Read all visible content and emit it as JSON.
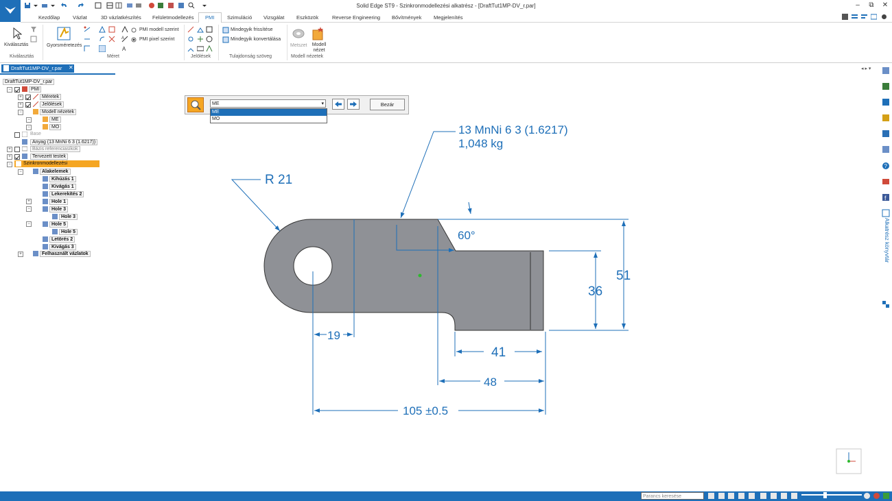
{
  "window": {
    "title": "Solid Edge ST9 - Szinkronmodellezési alkatrész - [DraftTut1MP-DV_r.par]"
  },
  "tabs": [
    "Kezdőlap",
    "Vázlat",
    "3D vázlatkészítés",
    "Felületmodellezés",
    "PMI",
    "Szimuláció",
    "Vizsgálat",
    "Eszközök",
    "Reverse Engineering",
    "Bővítmények",
    "Megjelenítés"
  ],
  "ribbon": {
    "select_label": "Kiválasztás",
    "select_group": "Kiválasztás",
    "quickdim_label": "Gyorsméretezés",
    "meret_group": "Méret",
    "pmi_model_label": "PMI modell szerint",
    "pmi_pixel_label": "PMI pixel szerint",
    "jelolesek_group": "Jelölések",
    "refresh_all_label": "Mindegyik frissítése",
    "convert_all_label": "Mindegyik konvertálása",
    "prop_text_group": "Tulajdonság szöveg",
    "section_label": "Metszet",
    "model_view_label": "Modell nézet",
    "model_views_group": "Modell nézetek"
  },
  "document": {
    "tab_label": "DraftTut1MP-DV_r.par",
    "close_glyph": "✕",
    "nav_arrows": "◂ ▸ ▾"
  },
  "tree": {
    "root": "DraftTut1MP-DV_r.par",
    "pmi": "PMI",
    "meretek": "Méretek",
    "jelolesek": "Jelölések",
    "modell_nezetek": "Modell nézetek",
    "view_me": "ME",
    "view_mo": "MO",
    "base": "Base",
    "anyag": "Anyag (13 MnNi 6 3  (1.6217))",
    "bazis": "Bázis referenciasíkok",
    "tervezett": "Tervezett testek",
    "szinkron": "Szinkronmodellezési",
    "alakelemek": "Alakelemek",
    "kihuzas1": "Kihúzás 1",
    "kivagas1": "Kivágás 1",
    "lekerekites2": "Lekerekítés 2",
    "hole1": "Hole 1",
    "hole3": "Hole 3",
    "hole3_child": "Hole 3",
    "hole5": "Hole 5",
    "hole5_child": "Hole 5",
    "letores2": "Letörés 2",
    "kivagas3": "Kivágás 3",
    "felhasznalt": "Felhasznált vázlatok"
  },
  "view_dialog": {
    "selected": "ME",
    "options": [
      "ME",
      "MO"
    ],
    "close_label": "Bezár"
  },
  "drawing": {
    "material": "13 MnNi 6 3  (1.6217)",
    "mass": "1,048 kg",
    "radius": "R 21",
    "angle": "60°",
    "dim_19": "19",
    "dim_36": "36",
    "dim_51": "51",
    "dim_41": "41",
    "dim_48": "48",
    "dim_105": "105 ±0.5",
    "dim_color": "#1e6fb8",
    "part_color": "#8f9196"
  },
  "rightbar": {
    "library_label": "Alkatrész könyvtár"
  },
  "status": {
    "search_placeholder": "Parancs keresése"
  },
  "colors": {
    "accent": "#1e6fb8",
    "highlight": "#f5a623"
  }
}
